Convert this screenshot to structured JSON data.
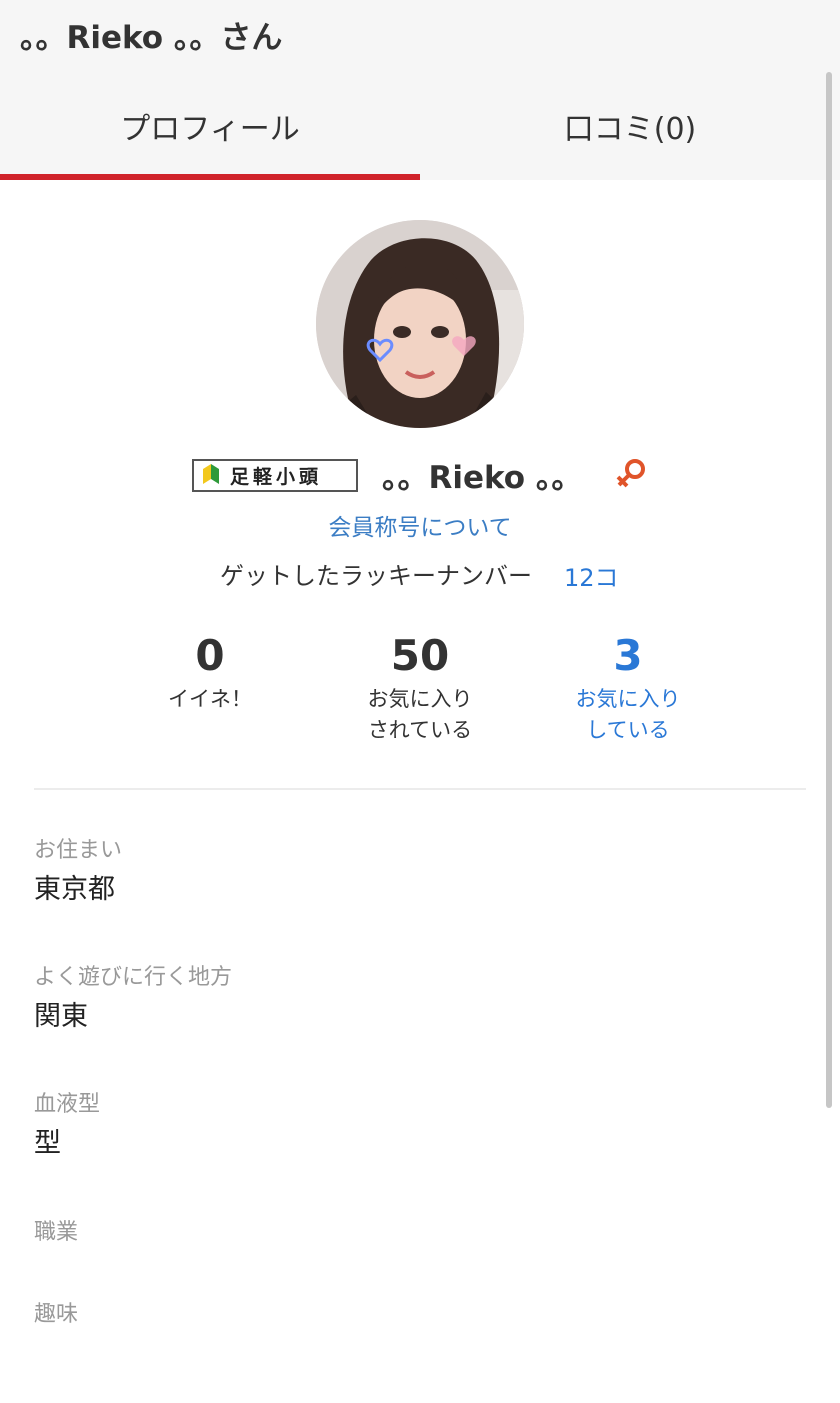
{
  "header": {
    "title": "。。Rieko 。。さん"
  },
  "tabs": [
    {
      "label": "プロフィール",
      "active": true
    },
    {
      "label": "口コミ(0)",
      "active": false
    }
  ],
  "profile": {
    "rank_badge": "足軽小頭",
    "name": "。。Rieko 。。",
    "gender_icon": "female-icon",
    "rank_link": "会員称号について",
    "lucky_label": "ゲットしたラッキーナンバー",
    "lucky_count": "12コ"
  },
  "stats": [
    {
      "value": "0",
      "label": "イイネ！"
    },
    {
      "value": "50",
      "label": "お気に入り\nされている"
    },
    {
      "value": "3",
      "label": "お気に入り\nしている"
    }
  ],
  "fields": [
    {
      "label": "お住まい",
      "value": "東京都"
    },
    {
      "label": "よく遊びに行く地方",
      "value": "関東"
    },
    {
      "label": "血液型",
      "value": "型"
    },
    {
      "label": "職業",
      "value": ""
    },
    {
      "label": "趣味",
      "value": ""
    }
  ],
  "colors": {
    "accent_tab": "#d0232a",
    "link": "#2a78d6",
    "gender": "#e0542a"
  }
}
